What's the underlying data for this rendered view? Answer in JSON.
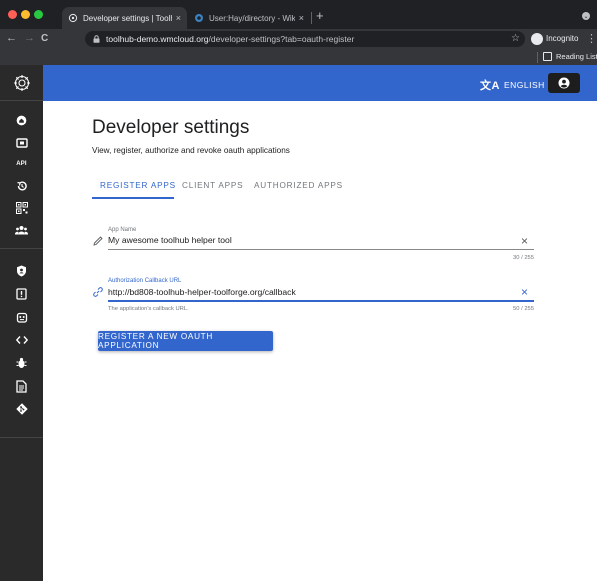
{
  "browser": {
    "tabs": [
      {
        "title": "Developer settings | Toolhub",
        "close": "×"
      },
      {
        "title": "User:Hay/directory - Wikitech",
        "close": "×"
      }
    ],
    "new_tab": "+",
    "nav": {
      "back": "←",
      "forward": "→",
      "reload": "C"
    },
    "url_host": "toolhub-demo.wmcloud.org",
    "url_path": "/developer-settings?tab=oauth-register",
    "star": "☆",
    "incognito_label": "Incognito",
    "menu": "⋮",
    "reading_list": "Reading List"
  },
  "appbar": {
    "language_glyph": "文A",
    "language_label": "ENGLISH"
  },
  "sidebar": {
    "items": [
      {
        "icon": "home-icon"
      },
      {
        "icon": "tools-icon"
      },
      {
        "icon": "api-text",
        "text": "API"
      },
      {
        "icon": "history-icon"
      },
      {
        "icon": "qr-icon"
      },
      {
        "icon": "people-icon"
      },
      {
        "icon": "shield-icon"
      },
      {
        "icon": "flag-icon"
      },
      {
        "icon": "robot-icon"
      },
      {
        "icon": "code-icon"
      },
      {
        "icon": "bug-icon"
      },
      {
        "icon": "document-icon"
      },
      {
        "icon": "git-icon"
      }
    ]
  },
  "page": {
    "title": "Developer settings",
    "subtitle": "View, register, authorize and revoke oauth applications",
    "tabs": [
      "REGISTER APPS",
      "CLIENT APPS",
      "AUTHORIZED APPS"
    ]
  },
  "form": {
    "app_name": {
      "label": "App Name",
      "value": "My awesome toolhub helper tool",
      "counter": "30 / 255",
      "clear": "×"
    },
    "callback_url": {
      "label": "Authorization Callback URL",
      "value": "http://bd808-toolhub-helper-toolforge.org/callback",
      "hint": "The application's callback URL.",
      "counter": "50 / 255",
      "clear": "×"
    },
    "submit_label": "REGISTER A NEW OAUTH APPLICATION"
  },
  "colors": {
    "accent": "#3366cc",
    "sidebar": "#2a2a2a",
    "chrome": "#202124"
  }
}
